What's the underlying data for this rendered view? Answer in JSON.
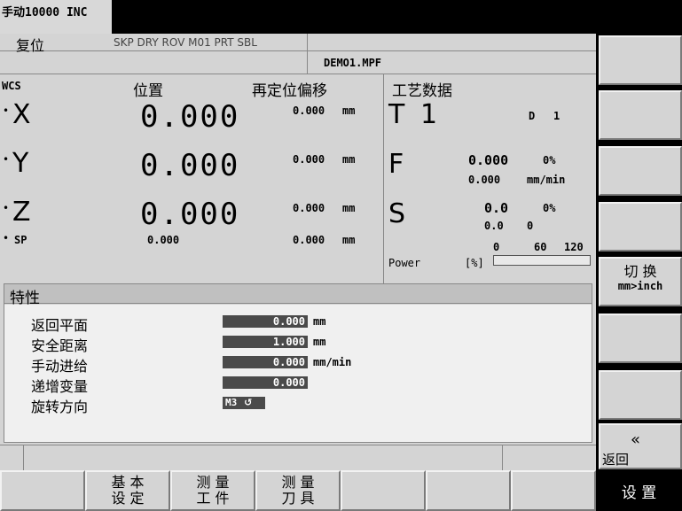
{
  "titlebar": {
    "mode_text": "手动10000 INC"
  },
  "status": {
    "reset_label": "复位",
    "flags": "SKP DRY ROV M01 PRT SBL",
    "program": "DEMO1.MPF"
  },
  "position_panel": {
    "wcs_label": "WCS",
    "position_header": "位置",
    "repos_header": "再定位偏移",
    "axes": [
      {
        "name": "X",
        "position": "0.000",
        "offset": "0.000",
        "unit": "mm"
      },
      {
        "name": "Y",
        "position": "0.000",
        "offset": "0.000",
        "unit": "mm"
      },
      {
        "name": "Z",
        "position": "0.000",
        "offset": "0.000",
        "unit": "mm"
      }
    ],
    "spindle": {
      "name": "SP",
      "position": "0.000",
      "offset": "0.000",
      "unit": "mm"
    }
  },
  "tech_panel": {
    "header": "工艺数据",
    "tool": {
      "letter": "T",
      "number": "1",
      "d_label": "D",
      "d_value": "1"
    },
    "feed": {
      "letter": "F",
      "actual": "0.000",
      "override": "0%",
      "setpoint": "0.000",
      "unit": "mm/min"
    },
    "spindle": {
      "letter": "S",
      "actual": "0.0",
      "override": "0%",
      "setpoint": "0.0",
      "extra": "0"
    },
    "power": {
      "label": "Power",
      "unit": "[%]",
      "ticks": [
        "0",
        "60",
        "120"
      ],
      "value": 0
    }
  },
  "properties": {
    "title": "特性",
    "rows": [
      {
        "label": "返回平面",
        "value": "0.000",
        "unit": "mm"
      },
      {
        "label": "安全距离",
        "value": "1.000",
        "unit": "mm"
      },
      {
        "label": "手动进给",
        "value": "0.000",
        "unit": "mm/min"
      },
      {
        "label": "递增变量",
        "value": "0.000",
        "unit": ""
      },
      {
        "label": "旋转方向",
        "value": "M3",
        "unit": ""
      }
    ]
  },
  "right_softkeys": {
    "switch_line1": "切 换",
    "switch_line2": "mm>inch",
    "back_arrow": "«",
    "back_label": "返回"
  },
  "bottom_softkeys": {
    "basic_l1": "基 本",
    "basic_l2": "设 定",
    "workpiece_l1": "测 量",
    "workpiece_l2": "工 件",
    "tool_l1": "测 量",
    "tool_l2": "刀 具",
    "settings": "设 置"
  }
}
